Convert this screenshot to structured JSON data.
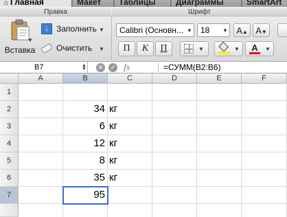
{
  "tabs": [
    {
      "label": "Главная",
      "active": true
    },
    {
      "label": "Макет",
      "active": false
    },
    {
      "label": "Таблицы",
      "active": false
    },
    {
      "label": "Диаграммы",
      "active": false
    },
    {
      "label": "SmartArt",
      "active": false
    }
  ],
  "ribbon": {
    "edit_group": "Правка",
    "font_group": "Шрифт",
    "paste_label": "Вставка",
    "fill_label": "Заполнить",
    "clear_label": "Очистить",
    "font_name": "Calibri (Основн...",
    "font_size": "18",
    "bold_label": "П",
    "italic_label": "К",
    "underline_label": "П"
  },
  "formula_bar": {
    "name_box": "B7",
    "fx_label": "fx",
    "formula": "=СУММ(B2:B6)"
  },
  "grid": {
    "columns": [
      "A",
      "B",
      "C",
      "D",
      "E",
      "F"
    ],
    "rows": [
      "1",
      "2",
      "3",
      "4",
      "5",
      "6",
      "7"
    ],
    "selected_cell": "B7",
    "cells": {
      "B2": "34",
      "C2": "кг",
      "B3": "6",
      "C3": "кг",
      "B4": "12",
      "C4": "кг",
      "B5": "8",
      "C5": "кг",
      "B6": "35",
      "C6": "кг",
      "B7": "95"
    }
  },
  "colors": {
    "accent": "#3a6fc4",
    "font_color": "#e01010",
    "highlight": "#f5e83a"
  }
}
